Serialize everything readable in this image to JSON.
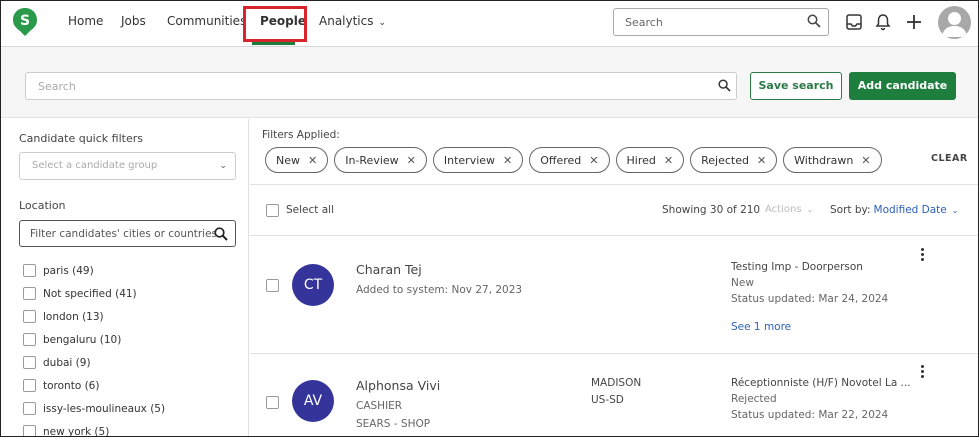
{
  "nav": {
    "logo_letter": "S",
    "items": [
      "Home",
      "Jobs",
      "Communities",
      "People",
      "Analytics"
    ],
    "search_placeholder": "Search"
  },
  "subbar": {
    "search_placeholder": "Search",
    "save_search_label": "Save search",
    "add_candidate_label": "Add candidate"
  },
  "sidebar": {
    "quick_filters_label": "Candidate quick filters",
    "group_select_placeholder": "Select a candidate group",
    "location_label": "Location",
    "location_placeholder": "Filter candidates' cities or countries",
    "locations": [
      "paris (49)",
      "Not specified (41)",
      "london (13)",
      "bengaluru (10)",
      "dubai (9)",
      "toronto (6)",
      "issy-les-moulineaux (5)",
      "new york (5)"
    ]
  },
  "filters": {
    "label": "Filters Applied:",
    "chips": [
      "New",
      "In-Review",
      "Interview",
      "Offered",
      "Hired",
      "Rejected",
      "Withdrawn"
    ],
    "clear_label": "CLEAR"
  },
  "list": {
    "select_all_label": "Select all",
    "showing_text": "Showing 30 of 210",
    "actions_label": "Actions",
    "sort_label": "Sort by:",
    "sort_value": "Modified Date"
  },
  "candidates": [
    {
      "initials": "CT",
      "name": "Charan Tej",
      "sub1": "Added to system: Nov 27, 2023",
      "job": "Testing Imp - Doorperson",
      "state": "New",
      "status_updated": "Status updated: Mar 24, 2024",
      "see_more": "See 1 more"
    },
    {
      "initials": "AV",
      "name": "Alphonsa Vivi",
      "sub1": "CASHIER",
      "sub2": "SEARS - SHOP",
      "location_line1": "MADISON",
      "location_line2": "US-SD",
      "job": "Réceptionniste (H/F) Novotel La ...",
      "state": "Rejected",
      "status_updated": "Status updated: Mar 22, 2024"
    }
  ],
  "colors": {
    "brand_green": "#1e7e3e",
    "highlight_red": "#d9232d",
    "avatar_purple": "#34349a",
    "link_blue": "#2c61b5"
  }
}
